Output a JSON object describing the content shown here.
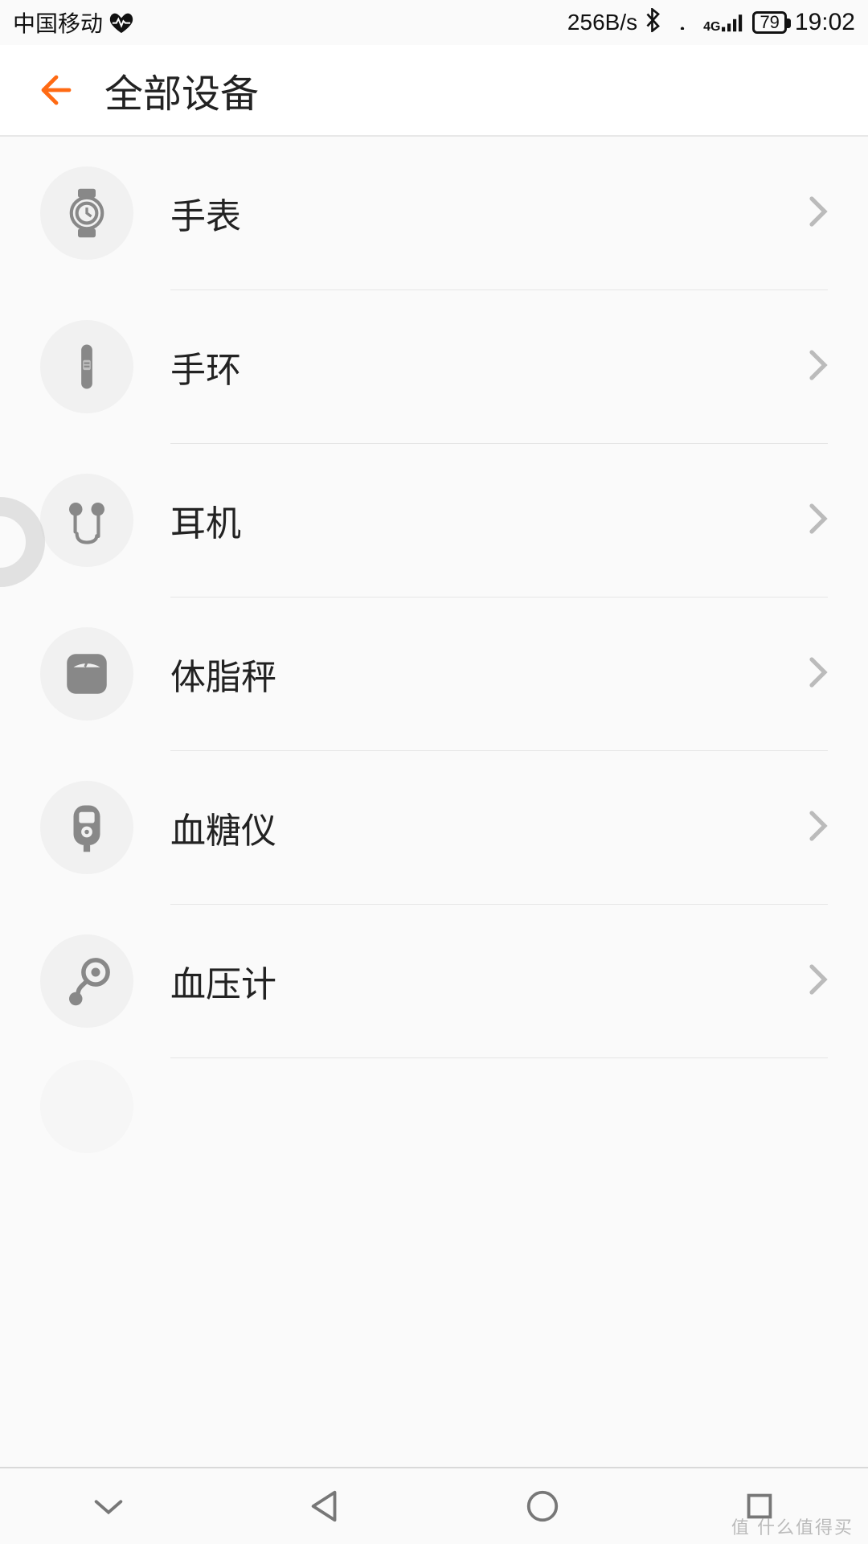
{
  "status": {
    "carrier": "中国移动",
    "data_rate": "256B/s",
    "network_label": "4G",
    "battery_percent": "79",
    "time": "19:02"
  },
  "header": {
    "title": "全部设备"
  },
  "items": [
    {
      "label": "手表",
      "icon": "watch"
    },
    {
      "label": "手环",
      "icon": "band"
    },
    {
      "label": "耳机",
      "icon": "earphones"
    },
    {
      "label": "体脂秤",
      "icon": "scale"
    },
    {
      "label": "血糖仪",
      "icon": "glucometer"
    },
    {
      "label": "血压计",
      "icon": "bp-monitor"
    }
  ],
  "watermark": "值 什么值得买"
}
